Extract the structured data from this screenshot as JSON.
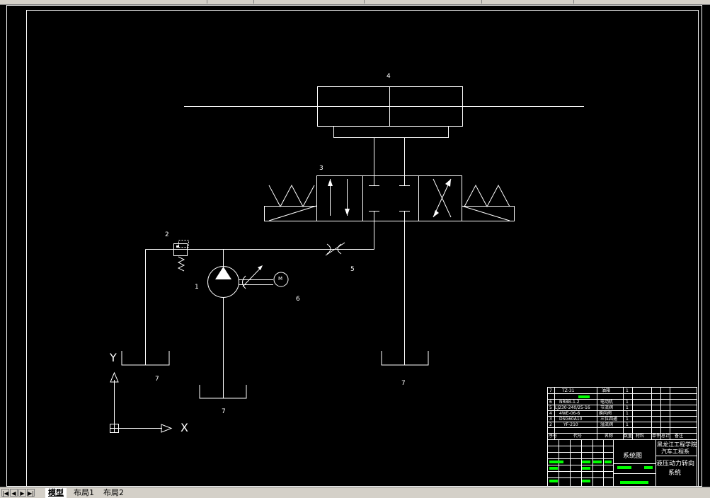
{
  "labels": {
    "cylinder": "4",
    "valve": "3",
    "relief": "2",
    "pump": "1",
    "motor": "6",
    "throttle": "5",
    "tank_left": "7",
    "tank_pump": "7",
    "tank_right": "7",
    "motor_symbol": "M"
  },
  "axes": {
    "x": "X",
    "y": "Y"
  },
  "title_block": {
    "parts": [
      {
        "no": "7",
        "code": "TZ-31",
        "name": "油箱",
        "qty": "1"
      },
      {
        "no": "6",
        "code": "NRBB-1.2",
        "name": "电动机",
        "qty": "1"
      },
      {
        "no": "5",
        "code": "LJ230-240/25-16",
        "name": "节流阀",
        "qty": "1"
      },
      {
        "no": "4",
        "code": "4WE-06-6",
        "name": "换向阀",
        "qty": "1"
      },
      {
        "no": "3",
        "code": "DSG60A10",
        "name": "三位四通",
        "qty": "1"
      },
      {
        "no": "2",
        "code": "YF-210",
        "name": "溢流阀",
        "qty": "1"
      }
    ],
    "headers": [
      "序号",
      "代号",
      "名称",
      "数量",
      "材料",
      "单件",
      "总计",
      "备注"
    ],
    "drawing_name": "系统图",
    "school": "黑龙江工程学院",
    "dept": "汽车工程系",
    "title_line1": "液压动力转向",
    "title_line2": "系统"
  },
  "tabs": {
    "model": "模型",
    "layout1": "布局1",
    "layout2": "布局2"
  },
  "nav": {
    "first": "|◀",
    "prev": "◀",
    "next": "▶",
    "last": "▶|"
  }
}
